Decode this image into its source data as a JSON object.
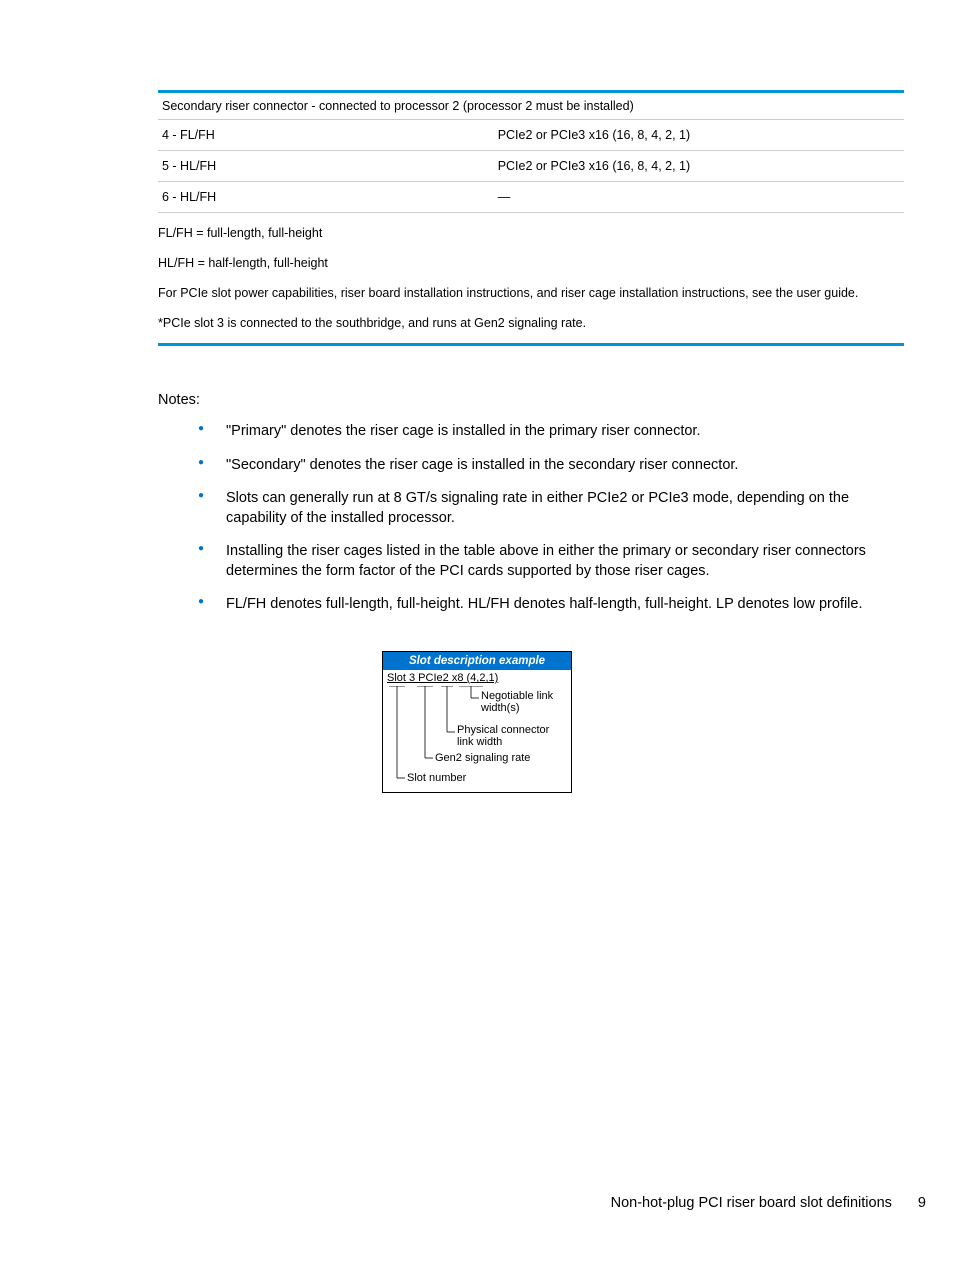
{
  "table": {
    "header": "Secondary riser connector - connected to processor 2 (processor 2 must be installed)",
    "rows": [
      {
        "slot": "4 - FL/FH",
        "spec": "PCIe2 or PCIe3 x16 (16, 8, 4, 2, 1)"
      },
      {
        "slot": "5 - HL/FH",
        "spec": "PCIe2 or PCIe3 x16 (16, 8, 4, 2, 1)"
      },
      {
        "slot": "6 - HL/FH",
        "spec": "—"
      }
    ]
  },
  "footnotes": {
    "f1": "FL/FH = full-length, full-height",
    "f2": "HL/FH = half-length, full-height",
    "f3": "For PCIe slot power capabilities, riser board installation instructions, and riser cage installation instructions, see the user guide.",
    "f4": "*PCIe slot 3 is connected to the southbridge, and runs at Gen2 signaling rate."
  },
  "notes_heading": "Notes:",
  "notes": [
    "\"Primary\" denotes the riser cage is installed in the primary riser connector.",
    "\"Secondary\" denotes the riser cage is installed in the secondary riser connector.",
    "Slots can generally run at 8 GT/s signaling rate in either PCIe2 or PCIe3 mode, depending on the capability of the installed processor.",
    "Installing the riser cages listed in the table above in either the primary or secondary riser connectors determines the form factor of the PCI cards supported by those riser cages.",
    "FL/FH denotes full-length, full-height. HL/FH denotes half-length, full-height. LP denotes low profile."
  ],
  "diagram": {
    "title": "Slot description example",
    "example": "Slot 3 PCIe2 x8 (4,2,1)",
    "labels": {
      "negotiable": "Negotiable link width(s)",
      "physical": "Physical connector link width",
      "signaling": "Gen2 signaling rate",
      "slotnum": "Slot number"
    }
  },
  "chart_data": {
    "type": "diagram",
    "title": "Slot description example",
    "example_string": "Slot 3 PCIe2 x8 (4,2,1)",
    "parts": [
      {
        "token": "Slot 3",
        "meaning": "Slot number"
      },
      {
        "token": "PCIe2",
        "meaning": "Gen2 signaling rate"
      },
      {
        "token": "x8",
        "meaning": "Physical connector link width"
      },
      {
        "token": "(4,2,1)",
        "meaning": "Negotiable link width(s)"
      }
    ]
  },
  "footer": {
    "title": "Non-hot-plug PCI riser board slot definitions",
    "page": "9"
  }
}
